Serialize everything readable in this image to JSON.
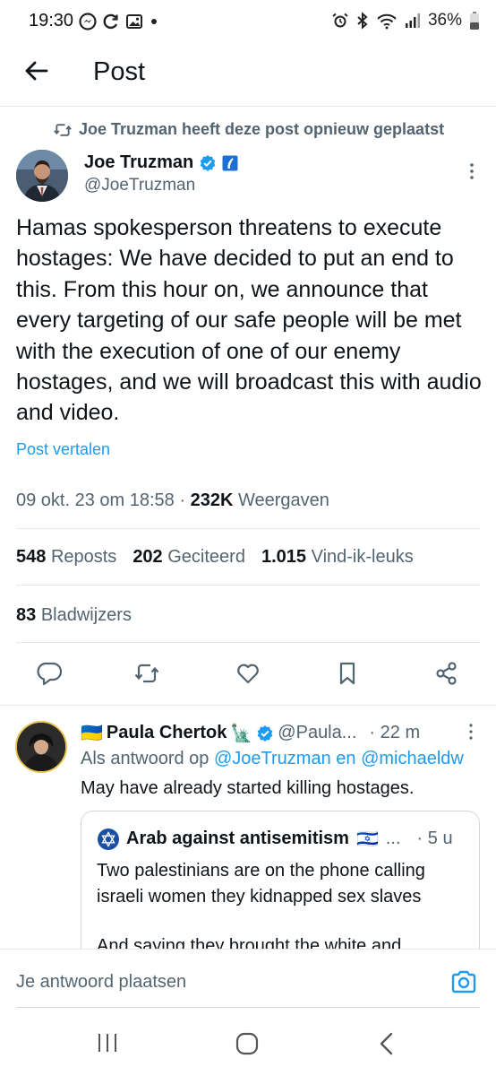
{
  "status_bar": {
    "time": "19:30",
    "battery": "36%",
    "icons_left": [
      "messenger-icon",
      "sync-icon",
      "gallery-icon",
      "dot-icon"
    ],
    "icons_right": [
      "alarm-icon",
      "bluetooth-icon",
      "wifi-icon",
      "signal-icon",
      "battery-icon"
    ]
  },
  "header": {
    "title": "Post"
  },
  "repost": {
    "text": "Joe Truzman heeft deze post opnieuw geplaatst"
  },
  "tweet": {
    "author_name": "Joe Truzman",
    "author_handle": "@JoeTruzman",
    "text": "Hamas spokesperson threatens to execute hostages: We have decided to put an end to this. From this hour on, we announce that every targeting of our safe people will be met with the execution of one of our enemy hostages, and we will broadcast this with audio and video.",
    "translate_label": "Post vertalen",
    "timestamp": "09 okt. 23 om 18:58",
    "separator": "·",
    "views_count": "232K",
    "views_label": "Weergaven",
    "reposts_count": "548",
    "reposts_label": "Reposts",
    "quotes_count": "202",
    "quotes_label": "Geciteerd",
    "likes_count": "1.015",
    "likes_label": "Vind-ik-leuks",
    "bookmarks_count": "83",
    "bookmarks_label": "Bladwijzers"
  },
  "reply": {
    "flag": "🇺🇦",
    "author_name": "Paula Chertok",
    "author_emoji": "🗽",
    "author_handle": "@Paula...",
    "time": "· 22 m",
    "reply_to_prefix": "Als antwoord op",
    "reply_to_user": "@JoeTruzman",
    "reply_to_and": "en",
    "reply_to_user2": "@michaeldw",
    "text": "May have already started killing hostages.",
    "quote": {
      "author_name": "Arab against antisemitism",
      "author_flag": "🇮🇱",
      "author_handle": "...",
      "time": "· 5 u",
      "text_line1": "Two palestinians are on the phone calling israeli women they kidnapped sex slaves",
      "text_line2": "And saying they brought the white and"
    }
  },
  "composer": {
    "placeholder": "Je antwoord plaatsen"
  },
  "colors": {
    "accent": "#1d9bf0",
    "secondary_text": "#536471",
    "primary_text": "#0f1419"
  }
}
